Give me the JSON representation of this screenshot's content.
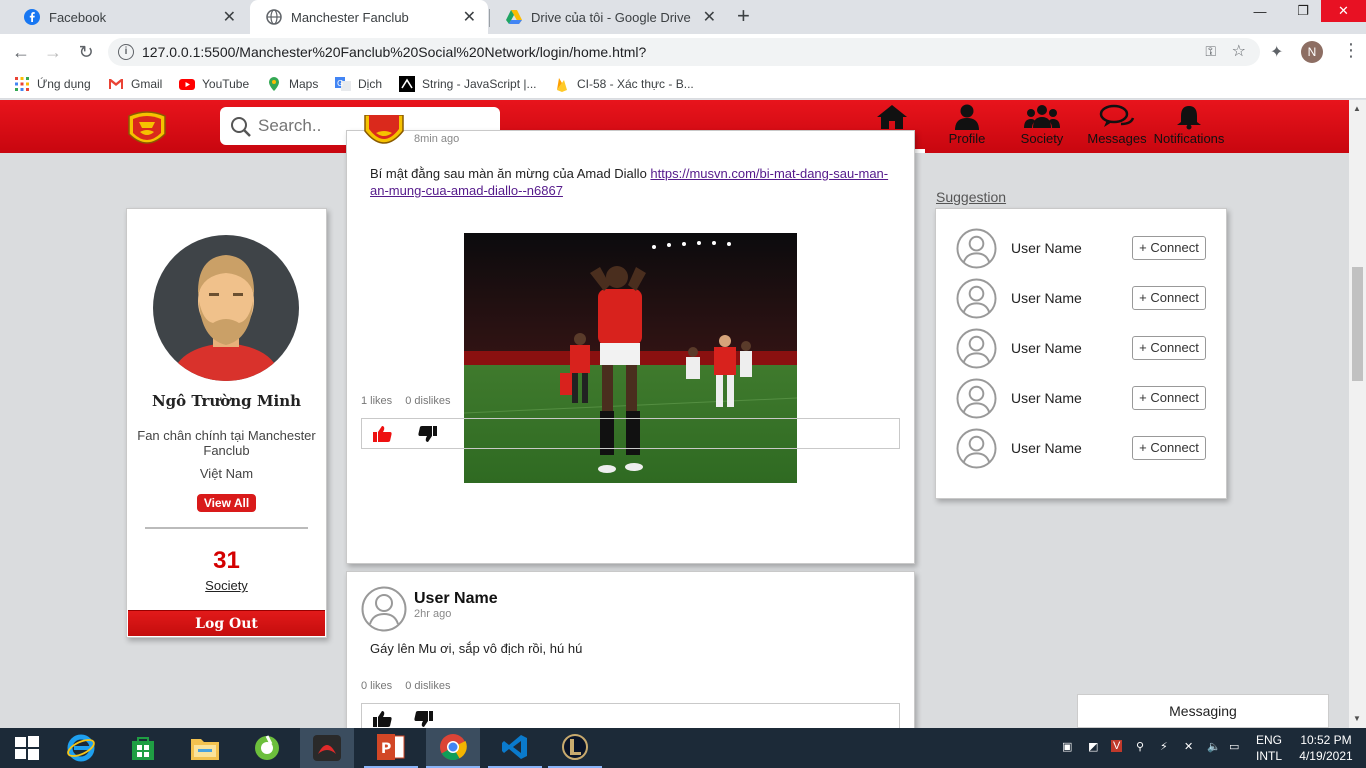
{
  "browser": {
    "tabs": [
      {
        "title": "Facebook",
        "active": false
      },
      {
        "title": "Manchester Fanclub",
        "active": true
      },
      {
        "title": "Drive của tôi - Google Drive",
        "active": false
      }
    ],
    "url": "127.0.0.1:5500/Manchester%20Fanclub%20Social%20Network/login/home.html?",
    "profile_initial": "N",
    "bookmarks": [
      {
        "label": "Ứng dụng",
        "icon": "apps-grid-icon"
      },
      {
        "label": "Gmail",
        "icon": "gmail-icon"
      },
      {
        "label": "YouTube",
        "icon": "youtube-icon"
      },
      {
        "label": "Maps",
        "icon": "maps-pin-icon"
      },
      {
        "label": "Dịch",
        "icon": "translate-icon"
      },
      {
        "label": "String - JavaScript |...",
        "icon": "mdn-icon"
      },
      {
        "label": "CI-58 - Xác thực - B...",
        "icon": "firebase-icon"
      }
    ]
  },
  "header": {
    "search_placeholder": "Search..",
    "nav": [
      {
        "label": "Home",
        "icon": "home-icon",
        "active": true
      },
      {
        "label": "Profile",
        "icon": "user-icon"
      },
      {
        "label": "Society",
        "icon": "users-icon"
      },
      {
        "label": "Messages",
        "icon": "chat-icon"
      },
      {
        "label": "Notifications",
        "icon": "bell-icon"
      }
    ],
    "brand_color": "#e0101a"
  },
  "profile": {
    "name": "Ngô Trường Minh",
    "bio": "Fan chân chính tại Manchester Fanclub",
    "country": "Việt Nam",
    "view_all": "View All",
    "society_count": "31",
    "society_label": "Society",
    "logout": "Log Out"
  },
  "feed": {
    "posts": [
      {
        "time": "8min ago",
        "text": "Bí mật đằng sau màn ăn mừng của Amad Diallo",
        "link": "https://musvn.com/bi-mat-dang-sau-man-an-mung-cua-amad-diallo--n6867",
        "likes": "1 likes",
        "dislikes": "0 dislikes"
      },
      {
        "author": "User Name",
        "time": "2hr ago",
        "text": "Gáy lên Mu ơi, sắp vô địch rồi, hú hú",
        "likes": "0 likes",
        "dislikes": "0 dislikes"
      }
    ]
  },
  "suggestion": {
    "title": "Suggestion",
    "users": [
      {
        "name": "User Name",
        "action": "Connect"
      },
      {
        "name": "User Name",
        "action": "Connect"
      },
      {
        "name": "User Name",
        "action": "Connect"
      },
      {
        "name": "User Name",
        "action": "Connect"
      },
      {
        "name": "User Name",
        "action": "Connect"
      }
    ]
  },
  "messaging": {
    "label": "Messaging"
  },
  "taskbar": {
    "lang_top": "ENG",
    "lang_bottom": "INTL",
    "time": "10:52 PM",
    "date": "4/19/2021"
  }
}
